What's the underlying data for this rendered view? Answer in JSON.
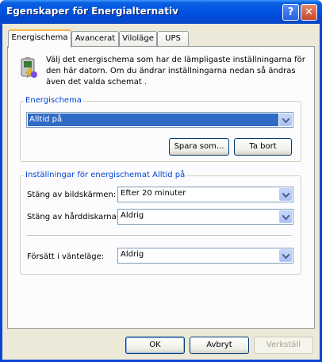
{
  "window": {
    "title": "Egenskaper för Energialternativ",
    "help_glyph": "?",
    "close_glyph": "✕"
  },
  "tabs": [
    {
      "label": "Energischema",
      "active": true
    },
    {
      "label": "Avancerat",
      "active": false
    },
    {
      "label": "Viloläge",
      "active": false
    },
    {
      "label": "UPS",
      "active": false
    }
  ],
  "intro": {
    "icon": "power-scheme-icon",
    "text": "Välj det energischema som har de lämpligaste inställningarna för den här datorn. Om du ändrar inställningarna nedan så ändras även det valda schemat ."
  },
  "scheme_group": {
    "label": "Energischema",
    "selected": "Alltid på",
    "save_as": "Spara som...",
    "delete": "Ta bort"
  },
  "settings_group": {
    "label": "Inställningar för energischemat Alltid på",
    "monitor_label": "Stäng av bildskärmen:",
    "monitor_value": "Efter 20 minuter",
    "disk_label": "Stäng av hårddiskarna:",
    "disk_value": "Aldrig",
    "standby_label": "Försätt i vänteläge:",
    "standby_value": "Aldrig"
  },
  "footer": {
    "ok": "OK",
    "cancel": "Avbryt",
    "apply": "Verkställ"
  },
  "colors": {
    "titlebar": "#0054e3",
    "accent": "#316ac5",
    "group_label": "#0046d5"
  }
}
